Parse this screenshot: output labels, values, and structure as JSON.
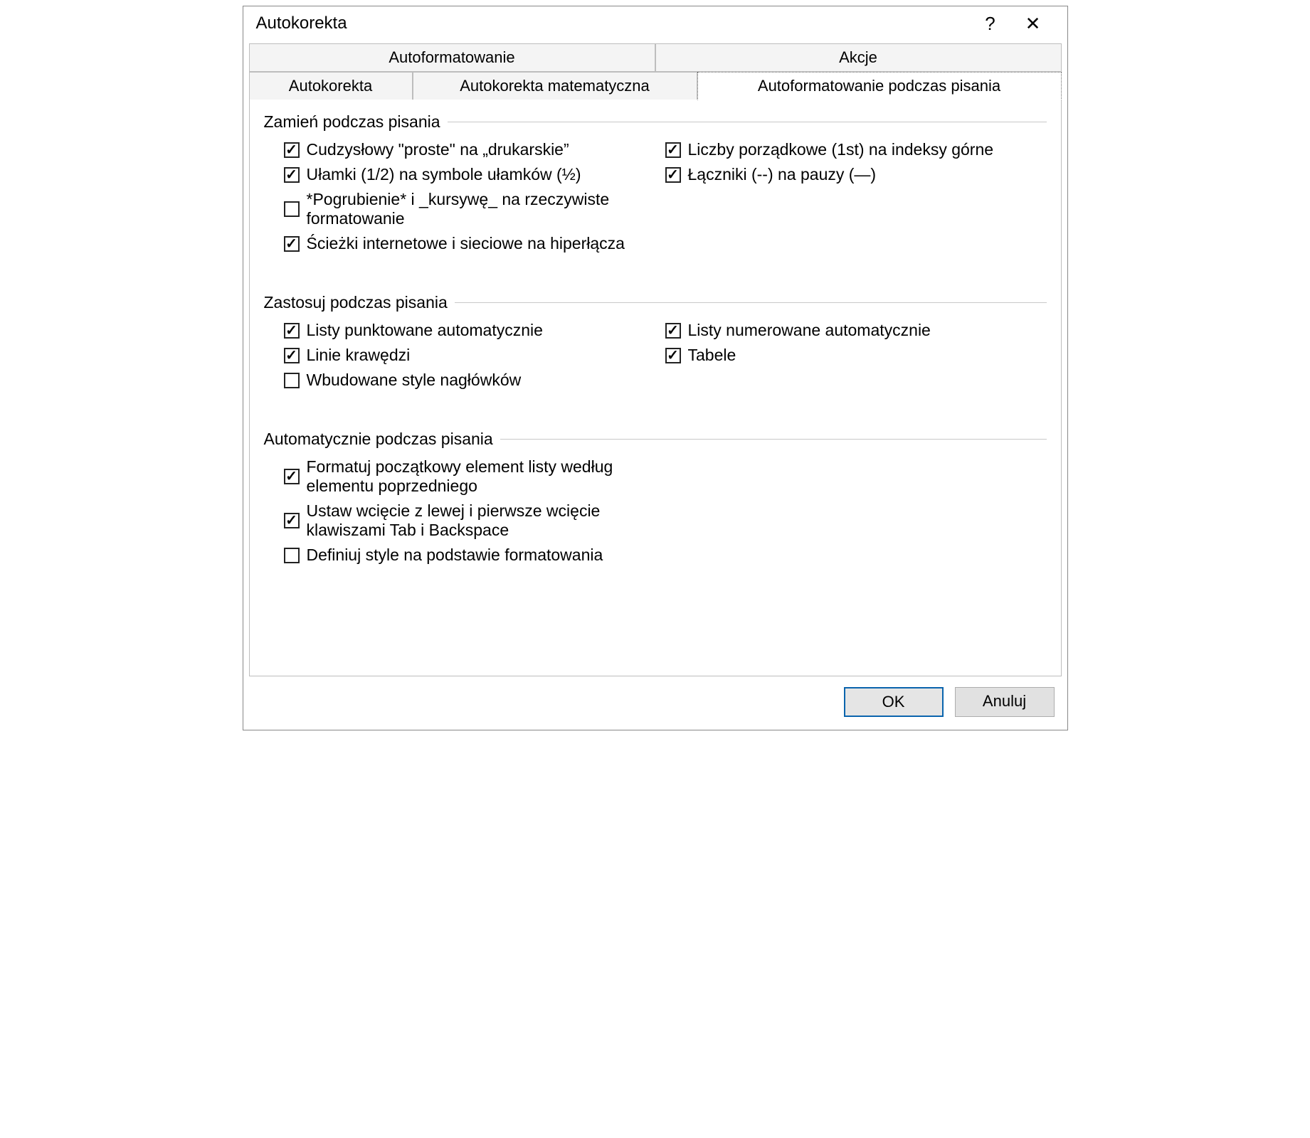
{
  "dialog": {
    "title": "Autokorekta",
    "help_char": "?",
    "close_char": "✕"
  },
  "tabs": {
    "top": [
      "Autoformatowanie",
      "Akcje"
    ],
    "bottom": [
      "Autokorekta",
      "Autokorekta matematyczna",
      "Autoformatowanie podczas pisania"
    ],
    "active": "Autoformatowanie podczas pisania"
  },
  "groups": [
    {
      "title": "Zamień podczas pisania",
      "rows": [
        [
          {
            "label": "Cudzysłowy \"proste\" na „drukarskie”",
            "checked": true
          },
          {
            "label": "Liczby porządkowe (1st) na indeksy górne",
            "checked": true
          }
        ],
        [
          {
            "label": "Ułamki (1/2) na symbole ułamków (½)",
            "checked": true
          },
          {
            "label": "Łączniki (--) na pauzy (—)",
            "checked": true
          }
        ],
        [
          {
            "label": "*Pogrubienie* i _kursywę_ na rzeczywiste formatowanie",
            "checked": false
          }
        ],
        [
          {
            "label": "Ścieżki internetowe i sieciowe na hiperłącza",
            "checked": true
          }
        ]
      ]
    },
    {
      "title": "Zastosuj podczas pisania",
      "rows": [
        [
          {
            "label": "Listy punktowane automatycznie",
            "checked": true
          },
          {
            "label": "Listy numerowane automatycznie",
            "checked": true
          }
        ],
        [
          {
            "label": "Linie krawędzi",
            "checked": true
          },
          {
            "label": "Tabele",
            "checked": true
          }
        ],
        [
          {
            "label": "Wbudowane style nagłówków",
            "checked": false
          }
        ]
      ]
    },
    {
      "title": "Automatycznie podczas pisania",
      "rows": [
        [
          {
            "label": "Formatuj początkowy element listy według elementu poprzedniego",
            "checked": true
          }
        ],
        [
          {
            "label": "Ustaw wcięcie z lewej i pierwsze wcięcie klawiszami Tab i Backspace",
            "checked": true
          }
        ],
        [
          {
            "label": "Definiuj style na podstawie formatowania",
            "checked": false
          }
        ]
      ]
    }
  ],
  "buttons": {
    "ok": "OK",
    "cancel": "Anuluj"
  }
}
